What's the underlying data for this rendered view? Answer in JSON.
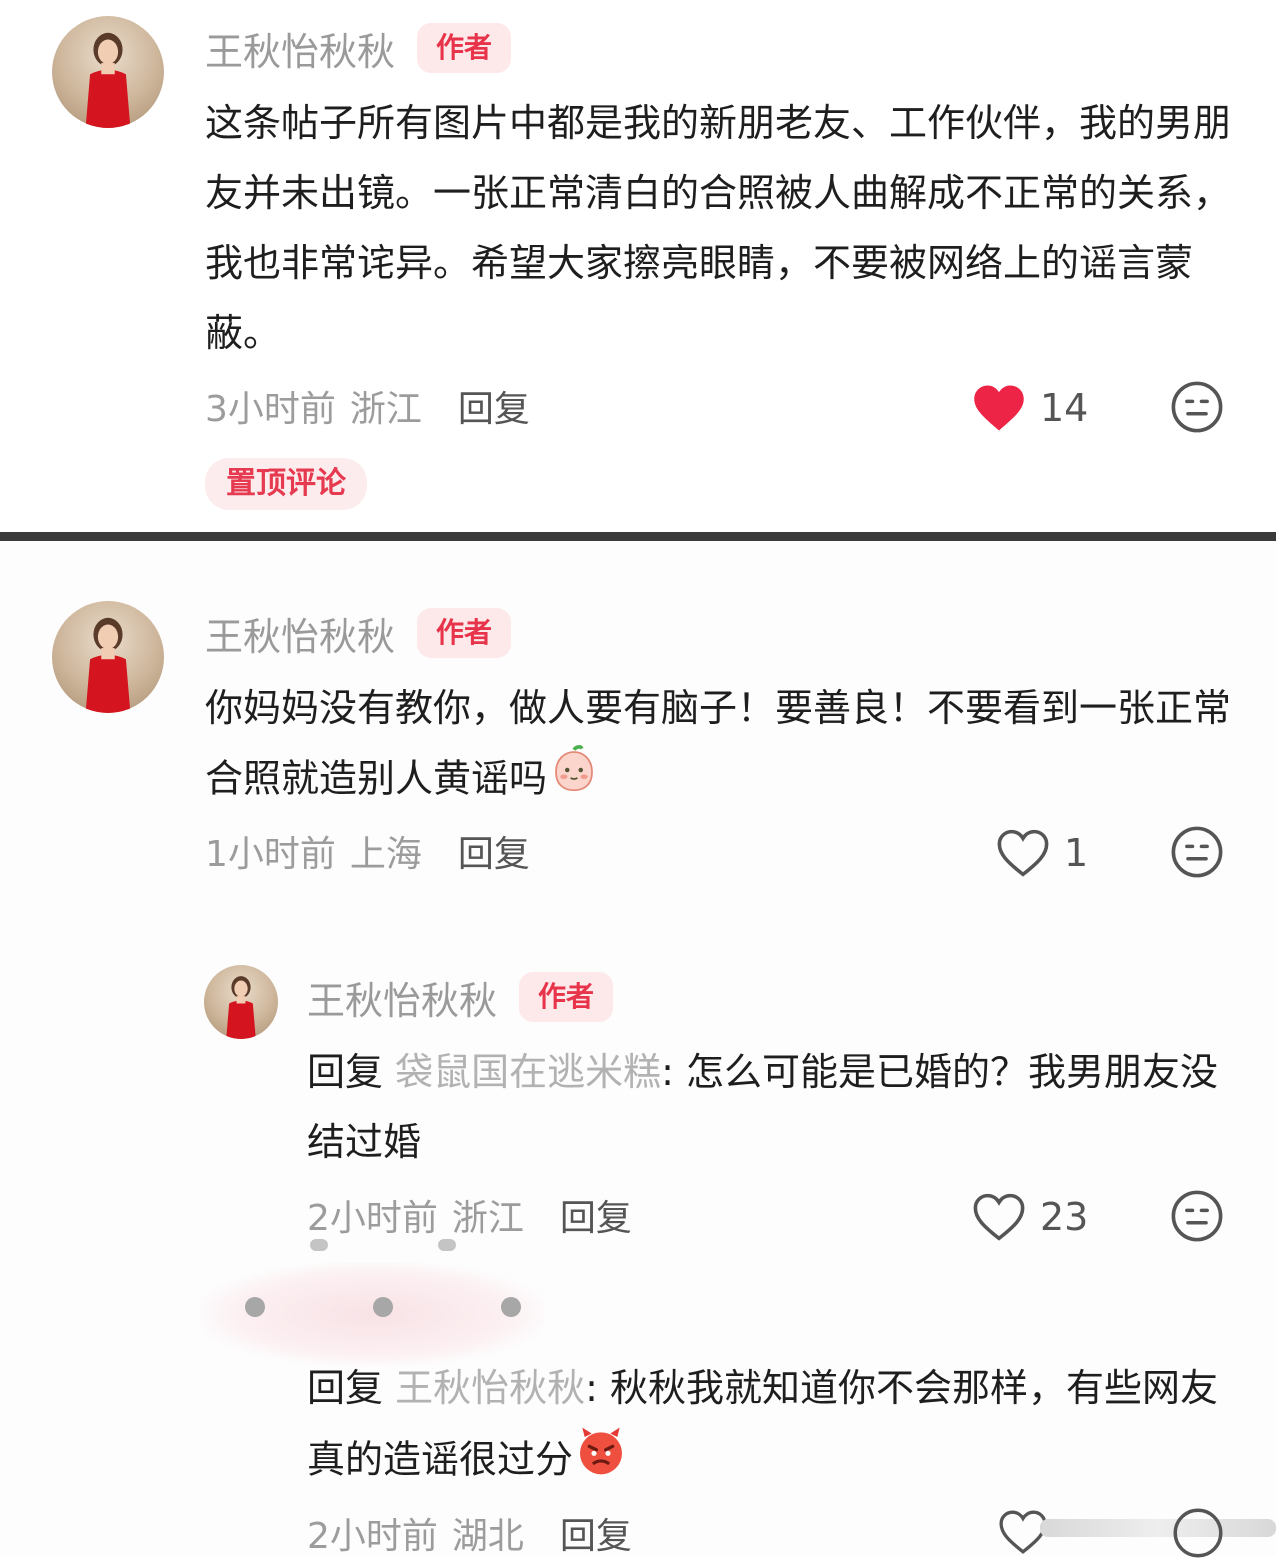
{
  "comments": [
    {
      "username": "王秋怡秋秋",
      "badge": "作者",
      "text": "这条帖子所有图片中都是我的新朋老友、工作伙伴，我的男朋友并未出镜。一张正常清白的合照被人曲解成不正常的关系，我也非常诧异。希望大家擦亮眼睛，不要被网络上的谣言蒙蔽。",
      "time": "3小时前",
      "location": "浙江",
      "reply_label": "回复",
      "likes": "14",
      "liked": true,
      "pinned_label": "置顶评论"
    },
    {
      "username": "王秋怡秋秋",
      "badge": "作者",
      "text": "你妈妈没有教你，做人要有脑子！要善良！不要看到一张正常合照就造别人黄谣吗",
      "emoji": "peach-face-emoji",
      "time": "1小时前",
      "location": "上海",
      "reply_label": "回复",
      "likes": "1",
      "liked": false
    },
    {
      "username": "王秋怡秋秋",
      "badge": "作者",
      "reply_prefix": "回复",
      "reply_target": "袋鼠国在逃米糕",
      "text": ": 怎么可能是已婚的？我男朋友没结过婚",
      "time": "2小时前",
      "location": "浙江",
      "reply_label": "回复",
      "likes": "23",
      "liked": false
    },
    {
      "reply_prefix": "回复",
      "reply_target": "王秋怡秋秋",
      "text": ": 秋秋我就知道你不会那样，有些网友真的造谣很过分",
      "emoji": "angry-devil-emoji",
      "time": "2小时前",
      "location": "湖北",
      "reply_label": "回复"
    }
  ],
  "icons": {
    "like": "heart-icon",
    "reaction": "meh-face-icon"
  },
  "colors": {
    "accent": "#e8344a",
    "liked_heart": "#ee2446",
    "muted_text": "#9c9c9c",
    "badge_bg": "#fde8ea"
  }
}
